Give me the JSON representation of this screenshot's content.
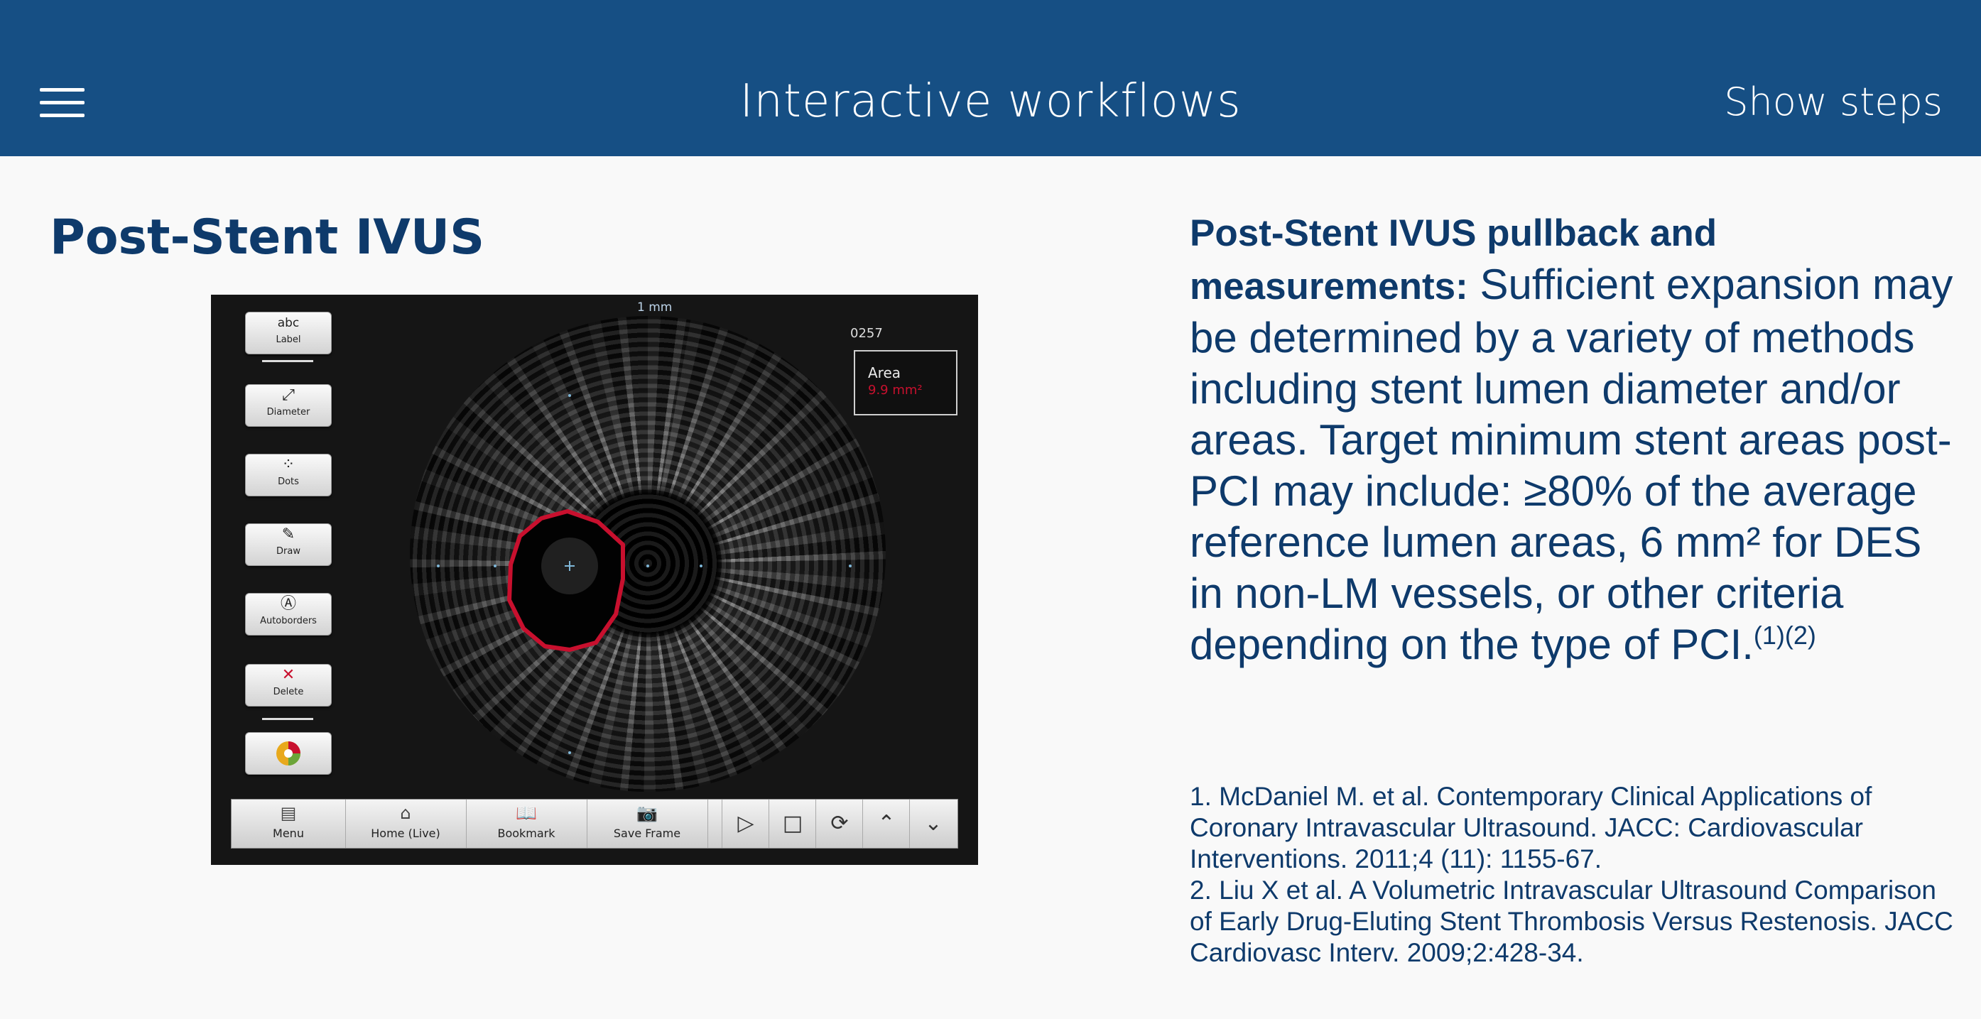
{
  "header": {
    "title": "Interactive workflows",
    "show_steps_label": "Show steps"
  },
  "left": {
    "title": "Post-Stent IVUS",
    "viewer": {
      "scale_label": "1 mm",
      "frame_number": "0257",
      "area_label": "Area",
      "area_value": "9.9 mm²",
      "tools": [
        {
          "label": "Label",
          "icon": "label-icon",
          "glyph": "abc"
        },
        {
          "label": "Diameter",
          "icon": "diameter-icon",
          "glyph": "⤢"
        },
        {
          "label": "Dots",
          "icon": "dots-icon",
          "glyph": "⁘"
        },
        {
          "label": "Draw",
          "icon": "draw-icon",
          "glyph": "✎"
        },
        {
          "label": "Autoborders",
          "icon": "autoborders-icon",
          "glyph": "Ⓐ"
        },
        {
          "label": "Delete",
          "icon": "delete-icon",
          "glyph": "✕"
        }
      ],
      "toolbar": {
        "menu": "Menu",
        "home": "Home (Live)",
        "bookmark": "Bookmark",
        "save_frame": "Save Frame"
      }
    }
  },
  "right": {
    "lead": "Post-Stent IVUS pullback and measurements:",
    "body": " Sufficient expansion may be determined by a variety of methods including stent lumen diameter and/or areas. Target minimum stent areas post-PCI may include: ≥80% of the average reference lumen areas, 6 mm² for DES in non-LM vessels, or other criteria depending on the type of PCI.",
    "citation_marks": "(1)(2)",
    "references": [
      "1. McDaniel M. et al. Contemporary Clinical Applications of Coronary Intravascular Ultrasound. JACC: Cardiovascular Interventions. 2011;4 (11): 1155-67.",
      "2. Liu X et al. A Volumetric Intravascular Ultrasound Comparison of Early Drug-Eluting Stent Thrombosis Versus Restenosis. JACC Cardiovasc Interv. 2009;2:428-34."
    ]
  },
  "colors": {
    "header_bg": "#164f84",
    "heading_text": "#0e3a6b",
    "lumen_contour": "#c8102e"
  }
}
